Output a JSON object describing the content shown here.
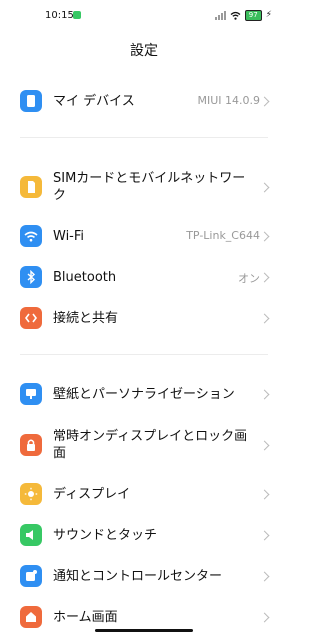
{
  "status": {
    "time": "10:15",
    "battery": "97"
  },
  "title": "設定",
  "items": [
    {
      "label": "マイ デバイス",
      "value": "MIUI 14.0.9",
      "icon": "phone-icon",
      "color": "#2f8ff2"
    },
    {
      "label": "SIMカードとモバイルネットワーク",
      "value": "",
      "icon": "sim-icon",
      "color": "#f5b93a"
    },
    {
      "label": "Wi-Fi",
      "value": "TP-Link_C644",
      "icon": "wifi-icon",
      "color": "#2f8ff2"
    },
    {
      "label": "Bluetooth",
      "value": "オン",
      "icon": "bluetooth-icon",
      "color": "#2f8ff2"
    },
    {
      "label": "接続と共有",
      "value": "",
      "icon": "share-icon",
      "color": "#ef6a3c"
    },
    {
      "label": "壁紙とパーソナライゼーション",
      "value": "",
      "icon": "wallpaper-icon",
      "color": "#2f8ff2"
    },
    {
      "label": "常時オンディスプレイとロック画面",
      "value": "",
      "icon": "lock-icon",
      "color": "#ef6a3c"
    },
    {
      "label": "ディスプレイ",
      "value": "",
      "icon": "display-icon",
      "color": "#f5b93a"
    },
    {
      "label": "サウンドとタッチ",
      "value": "",
      "icon": "sound-icon",
      "color": "#37c864"
    },
    {
      "label": "通知とコントロールセンター",
      "value": "",
      "icon": "notification-icon",
      "color": "#2f8ff2"
    },
    {
      "label": "ホーム画面",
      "value": "",
      "icon": "home-icon",
      "color": "#ef6a3c"
    }
  ]
}
